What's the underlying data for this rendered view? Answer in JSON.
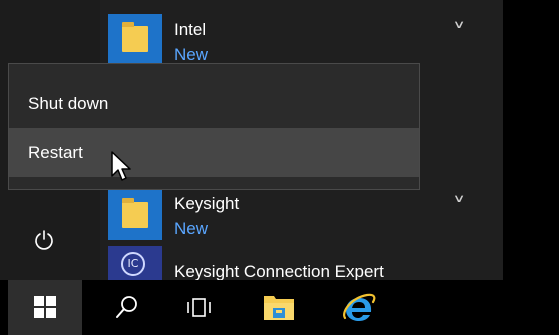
{
  "apps": [
    {
      "name": "Intel",
      "badge": "New"
    },
    {
      "name": "Keysight",
      "badge": "New"
    },
    {
      "name": "Keysight Connection Expert",
      "badge": ""
    }
  ],
  "app_icons": {
    "folder": "folder-icon",
    "connection_expert": "IC"
  },
  "power_menu": {
    "items": [
      {
        "label": "Shut down"
      },
      {
        "label": "Restart"
      }
    ],
    "hovered": "Restart"
  },
  "taskbar": {
    "buttons": [
      "windows-start",
      "search",
      "task-view",
      "file-explorer",
      "internet-explorer"
    ]
  },
  "colors": {
    "accent": "#1e73c9",
    "badge_text": "#5aa6ff",
    "menu_bg": "#2b2b2b",
    "hover_bg": "#464646",
    "folder": "#f5cc52"
  }
}
